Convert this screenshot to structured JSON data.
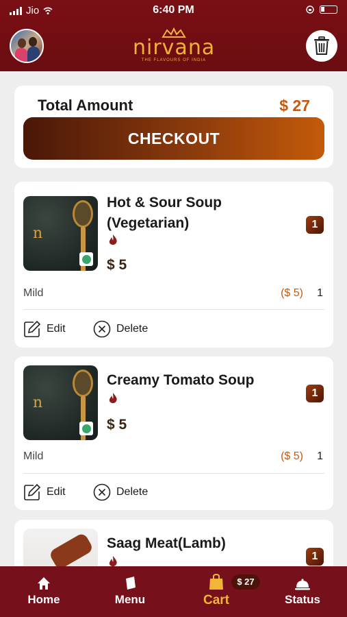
{
  "status_bar": {
    "carrier": "Jio",
    "time": "6:40 PM"
  },
  "brand": {
    "name": "nirvana",
    "tagline": "THE FLAVOURS OF INDIA"
  },
  "summary": {
    "total_label": "Total Amount",
    "total_amount": "$ 27",
    "checkout_label": "CHECKOUT"
  },
  "items": [
    {
      "name": "Hot & Sour Soup (Vegetarian)",
      "price": "$ 5",
      "qty": "1",
      "spice": "Mild",
      "line_price": "($ 5)",
      "line_qty": "1",
      "edit_label": "Edit",
      "delete_label": "Delete"
    },
    {
      "name": "Creamy Tomato Soup",
      "price": "$ 5",
      "qty": "1",
      "spice": "Mild",
      "line_price": "($ 5)",
      "line_qty": "1",
      "edit_label": "Edit",
      "delete_label": "Delete"
    },
    {
      "name": "Saag Meat(Lamb)",
      "qty": "1"
    }
  ],
  "nav": {
    "home": "Home",
    "menu": "Menu",
    "cart": "Cart",
    "cart_badge": "$ 27",
    "status": "Status"
  },
  "colors": {
    "header": "#76101a",
    "accent": "#c9580a",
    "active_tab": "#f2b53a"
  }
}
